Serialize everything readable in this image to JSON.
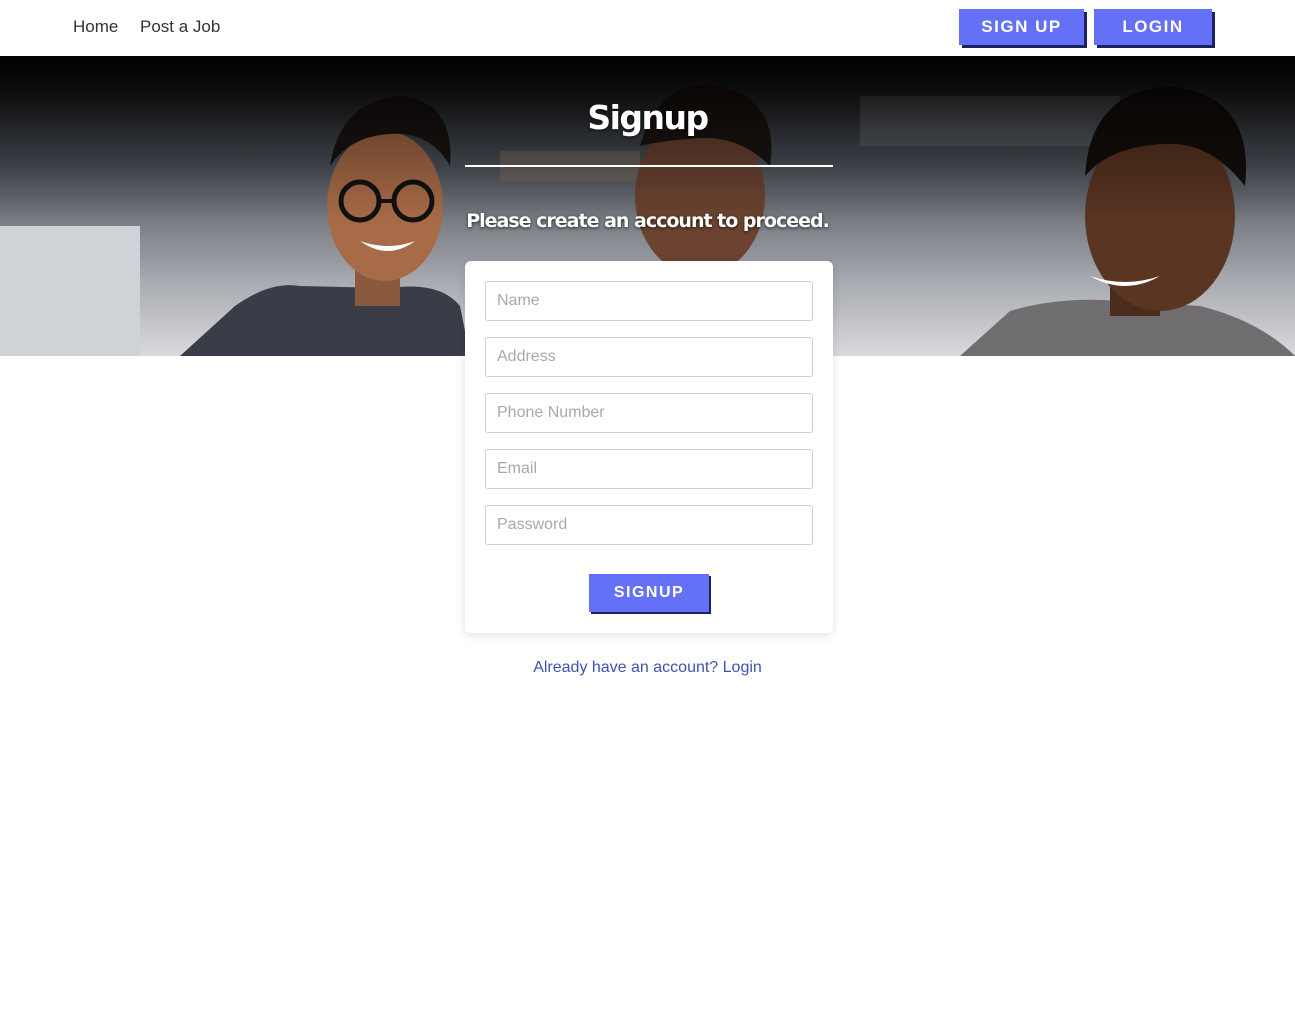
{
  "nav": {
    "links": [
      "Home",
      "Post a Job"
    ],
    "signup_label": "SIGN UP",
    "login_label": "LOGIN"
  },
  "hero": {
    "title": "Signup",
    "subtitle": "Please create an account to proceed."
  },
  "form": {
    "fields": [
      {
        "placeholder": "Name",
        "value": ""
      },
      {
        "placeholder": "Address",
        "value": ""
      },
      {
        "placeholder": "Phone Number",
        "value": ""
      },
      {
        "placeholder": "Email",
        "value": ""
      },
      {
        "placeholder": "Password",
        "value": ""
      }
    ],
    "submit_label": "SIGNUP"
  },
  "footer": {
    "login_prompt": "Already have an account? Login"
  },
  "colors": {
    "accent": "#6471f7",
    "link": "#3f51b5"
  }
}
